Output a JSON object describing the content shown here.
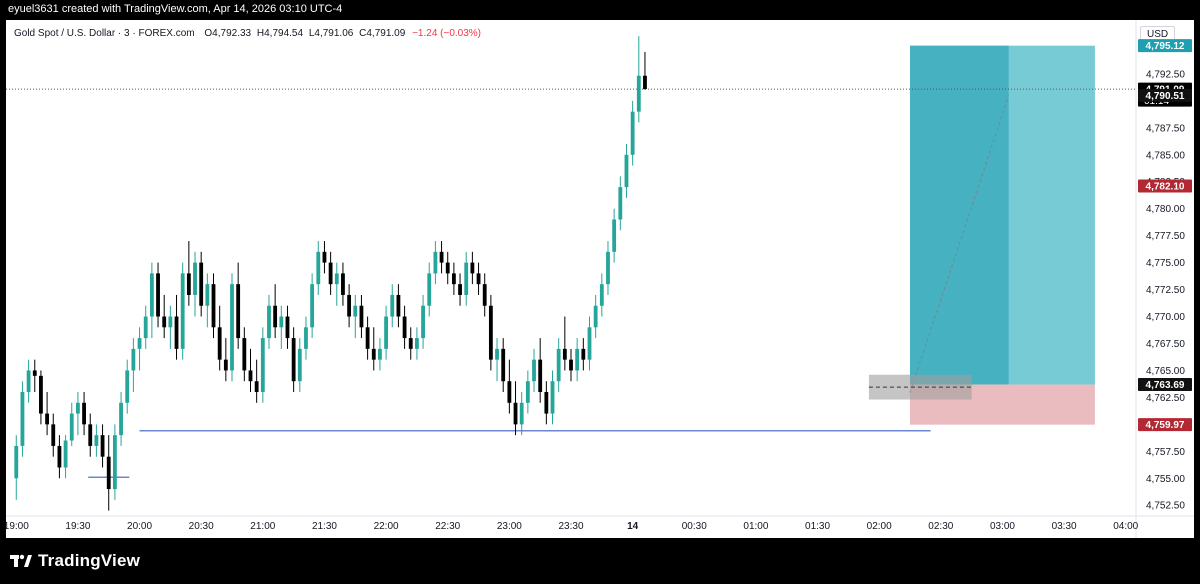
{
  "watermark": "eyuel3631 created with TradingView.com, Apr 14, 2026 03:10 UTC-4",
  "header": {
    "symbol": "Gold Spot / U.S. Dollar · 3 · FOREX.com",
    "o_label": "O",
    "o_value": "4,792.33",
    "h_label": "H",
    "h_value": "4,794.54",
    "l_label": "L",
    "l_value": "4,791.06",
    "c_label": "C",
    "c_value": "4,791.09",
    "change": "−1.24 (−0.03%)"
  },
  "currency": "USD",
  "footer": {
    "brand": "TradingView"
  },
  "colors": {
    "up": "#26a69a",
    "down": "#000000",
    "target_zone": "#2eafbf",
    "stop_zone": "#e8b4b8",
    "price_tag": "#000000",
    "stop_tag": "#b22833",
    "target_tag": "#1f9fb0"
  },
  "chart_data": {
    "type": "candlestick",
    "ylim": [
      4751.5,
      4797.5
    ],
    "x_time_domain": [
      "18:55",
      "04:05"
    ],
    "y_ticks": [
      "4,752.50",
      "4,755.00",
      "4,757.50",
      "4,760.00",
      "4,762.50",
      "4,765.00",
      "4,767.50",
      "4,770.00",
      "4,772.50",
      "4,775.00",
      "4,777.50",
      "4,780.00",
      "4,782.50",
      "4,785.00",
      "4,787.50",
      "4,790.00",
      "4,792.50"
    ],
    "x_ticks": [
      {
        "label": "19:00",
        "t": "19:00"
      },
      {
        "label": "19:30",
        "t": "19:30"
      },
      {
        "label": "20:00",
        "t": "20:00"
      },
      {
        "label": "20:30",
        "t": "20:30"
      },
      {
        "label": "21:00",
        "t": "21:00"
      },
      {
        "label": "21:30",
        "t": "21:30"
      },
      {
        "label": "22:00",
        "t": "22:00"
      },
      {
        "label": "22:30",
        "t": "22:30"
      },
      {
        "label": "23:00",
        "t": "23:00"
      },
      {
        "label": "23:30",
        "t": "23:30"
      },
      {
        "label": "14",
        "t": "00:00"
      },
      {
        "label": "00:30",
        "t": "00:30"
      },
      {
        "label": "01:00",
        "t": "01:00"
      },
      {
        "label": "01:30",
        "t": "01:30"
      },
      {
        "label": "02:00",
        "t": "02:00"
      },
      {
        "label": "02:30",
        "t": "02:30"
      },
      {
        "label": "03:00",
        "t": "03:00"
      },
      {
        "label": "03:30",
        "t": "03:30"
      },
      {
        "label": "04:00",
        "t": "04:00"
      }
    ],
    "price_labels": [
      {
        "text": "4,795.12",
        "value": 4795.12,
        "kind": "target"
      },
      {
        "text": "4,791.09",
        "value": 4791.09,
        "kind": "last",
        "sub": "01:14"
      },
      {
        "text": "4,790.51",
        "value": 4790.51,
        "kind": "dark"
      },
      {
        "text": "4,782.10",
        "value": 4782.1,
        "kind": "stop"
      },
      {
        "text": "4,763.69",
        "value": 4763.69,
        "kind": "entry"
      },
      {
        "text": "4,759.97",
        "value": 4759.97,
        "kind": "stop"
      }
    ],
    "last_price": 4791.09,
    "position": {
      "type": "long",
      "start": "02:15",
      "end": "03:45",
      "entry": 4763.69,
      "target": 4795.12,
      "stop": 4759.97,
      "split": "03:03"
    },
    "horizontal_lines": [
      {
        "from": "20:00",
        "to": "02:25",
        "value": 4759.4
      },
      {
        "from": "19:35",
        "to": "19:55",
        "value": 4755.1
      }
    ],
    "gray_box": {
      "from": "01:55",
      "to": "02:45",
      "top": 4764.6,
      "bottom": 4762.3
    },
    "candle_times": {
      "start": "19:00",
      "interval_min": 3
    },
    "candles": [
      [
        4755,
        4759,
        4753,
        4758
      ],
      [
        4758,
        4764,
        4757,
        4763
      ],
      [
        4763,
        4766,
        4762,
        4765
      ],
      [
        4765,
        4766,
        4763,
        4764.5
      ],
      [
        4764.5,
        4765,
        4760,
        4761
      ],
      [
        4761,
        4763,
        4759,
        4760
      ],
      [
        4760,
        4761,
        4757,
        4758
      ],
      [
        4758,
        4759,
        4755,
        4756
      ],
      [
        4756,
        4759,
        4755,
        4758.5
      ],
      [
        4758.5,
        4762,
        4758,
        4761
      ],
      [
        4761,
        4763,
        4759,
        4762
      ],
      [
        4762,
        4763,
        4759,
        4760
      ],
      [
        4760,
        4761,
        4757,
        4758
      ],
      [
        4758,
        4760,
        4757,
        4759
      ],
      [
        4759,
        4760,
        4756,
        4757
      ],
      [
        4757,
        4759,
        4752,
        4754
      ],
      [
        4754,
        4760,
        4753,
        4759
      ],
      [
        4759,
        4763,
        4758,
        4762
      ],
      [
        4762,
        4766,
        4761,
        4765
      ],
      [
        4765,
        4768,
        4763,
        4767
      ],
      [
        4767,
        4769,
        4765,
        4768
      ],
      [
        4768,
        4771,
        4767,
        4770
      ],
      [
        4770,
        4775,
        4768,
        4774
      ],
      [
        4774,
        4775,
        4769,
        4770
      ],
      [
        4770,
        4772,
        4768,
        4769
      ],
      [
        4769,
        4771,
        4767,
        4770
      ],
      [
        4770,
        4772,
        4766,
        4767
      ],
      [
        4767,
        4775,
        4766,
        4774
      ],
      [
        4774,
        4777,
        4771,
        4772
      ],
      [
        4772,
        4776,
        4770,
        4775
      ],
      [
        4775,
        4776,
        4770,
        4771
      ],
      [
        4771,
        4774,
        4769,
        4773
      ],
      [
        4773,
        4774,
        4768,
        4769
      ],
      [
        4769,
        4771,
        4765,
        4766
      ],
      [
        4766,
        4768,
        4764,
        4765
      ],
      [
        4765,
        4774,
        4764,
        4773
      ],
      [
        4773,
        4775,
        4767,
        4768
      ],
      [
        4768,
        4769,
        4764,
        4765
      ],
      [
        4765,
        4767,
        4763,
        4764
      ],
      [
        4764,
        4766,
        4762,
        4763
      ],
      [
        4763,
        4769,
        4762,
        4768
      ],
      [
        4768,
        4772,
        4767,
        4771
      ],
      [
        4771,
        4773,
        4768,
        4769
      ],
      [
        4769,
        4771,
        4767,
        4770
      ],
      [
        4770,
        4771,
        4767,
        4768
      ],
      [
        4768,
        4769,
        4763,
        4764
      ],
      [
        4764,
        4768,
        4763,
        4767
      ],
      [
        4767,
        4770,
        4766,
        4769
      ],
      [
        4769,
        4774,
        4768,
        4773
      ],
      [
        4773,
        4777,
        4772,
        4776
      ],
      [
        4776,
        4777,
        4774,
        4775
      ],
      [
        4775,
        4776,
        4772,
        4773
      ],
      [
        4773,
        4775,
        4771,
        4774
      ],
      [
        4774,
        4775,
        4771,
        4772
      ],
      [
        4772,
        4773,
        4769,
        4770
      ],
      [
        4770,
        4772,
        4768,
        4771
      ],
      [
        4771,
        4772,
        4768,
        4769
      ],
      [
        4769,
        4770,
        4766,
        4767
      ],
      [
        4767,
        4769,
        4765,
        4766
      ],
      [
        4766,
        4768,
        4765,
        4767
      ],
      [
        4767,
        4771,
        4766,
        4770
      ],
      [
        4770,
        4773,
        4769,
        4772
      ],
      [
        4772,
        4773,
        4769,
        4770
      ],
      [
        4770,
        4771,
        4767,
        4768
      ],
      [
        4768,
        4769,
        4766,
        4767
      ],
      [
        4767,
        4769,
        4766,
        4768
      ],
      [
        4768,
        4772,
        4767,
        4771
      ],
      [
        4771,
        4775,
        4770,
        4774
      ],
      [
        4774,
        4777,
        4773,
        4776
      ],
      [
        4776,
        4777,
        4774,
        4775
      ],
      [
        4775,
        4776,
        4773,
        4774
      ],
      [
        4774,
        4775,
        4772,
        4773
      ],
      [
        4773,
        4774,
        4771,
        4772
      ],
      [
        4772,
        4776,
        4771,
        4775
      ],
      [
        4775,
        4776,
        4773,
        4774
      ],
      [
        4774,
        4775,
        4772,
        4773
      ],
      [
        4773,
        4774,
        4770,
        4771
      ],
      [
        4771,
        4772,
        4765,
        4766
      ],
      [
        4766,
        4768,
        4764,
        4767
      ],
      [
        4767,
        4768,
        4763,
        4764
      ],
      [
        4764,
        4766,
        4761,
        4762
      ],
      [
        4762,
        4764,
        4759,
        4760
      ],
      [
        4760,
        4763,
        4759,
        4762
      ],
      [
        4762,
        4765,
        4761,
        4764
      ],
      [
        4764,
        4767,
        4763,
        4766
      ],
      [
        4766,
        4768,
        4762,
        4763
      ],
      [
        4763,
        4764,
        4760,
        4761
      ],
      [
        4761,
        4765,
        4760,
        4764
      ],
      [
        4764,
        4768,
        4763,
        4767
      ],
      [
        4767,
        4770,
        4765,
        4766
      ],
      [
        4766,
        4767,
        4764,
        4765
      ],
      [
        4765,
        4768,
        4764,
        4767
      ],
      [
        4767,
        4768,
        4765,
        4766
      ],
      [
        4766,
        4770,
        4765,
        4769
      ],
      [
        4769,
        4772,
        4768,
        4771
      ],
      [
        4771,
        4774,
        4770,
        4773
      ],
      [
        4773,
        4777,
        4772,
        4776
      ],
      [
        4776,
        4780,
        4775,
        4779
      ],
      [
        4779,
        4783,
        4778,
        4782
      ],
      [
        4782,
        4786,
        4781,
        4785
      ],
      [
        4785,
        4790,
        4784,
        4789
      ],
      [
        4789,
        4796,
        4788,
        4792.33
      ],
      [
        4792.33,
        4794.54,
        4791.06,
        4791.09
      ]
    ]
  }
}
